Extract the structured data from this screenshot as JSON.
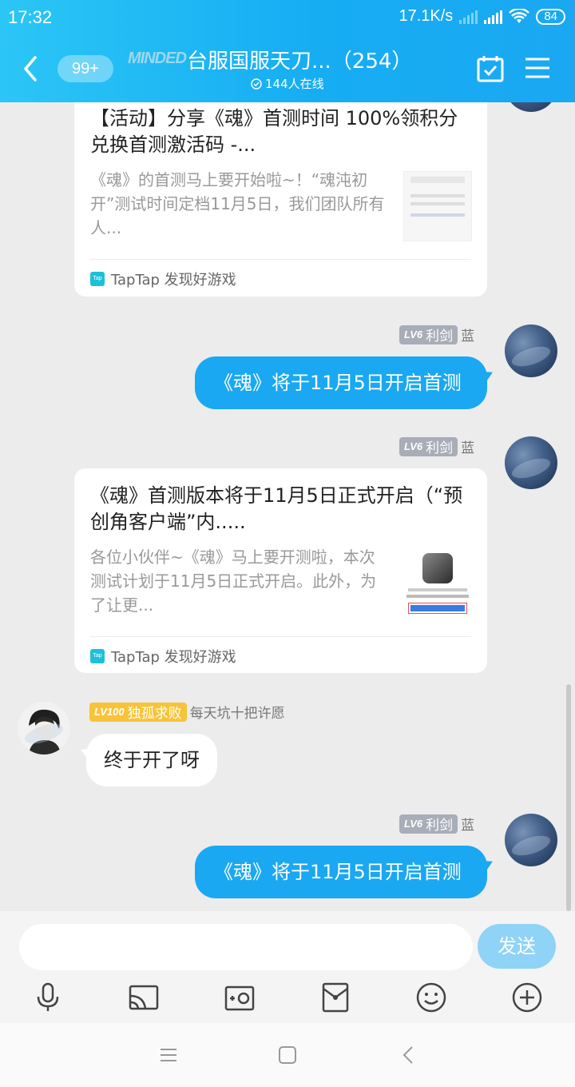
{
  "status_bar": {
    "time": "17:32",
    "speed": "17.1K/s",
    "battery": "84"
  },
  "header": {
    "unread_badge": "99+",
    "brand_logo": "MINDED",
    "title": "台服国服天刀...（254）",
    "online": "144人在线",
    "icons": [
      "back-icon",
      "calendar-check-icon",
      "menu-icon"
    ]
  },
  "messages": [
    {
      "type": "link_card",
      "title": "【活动】分享《魂》首测时间 100%领积分兑换首测激活码 -...",
      "description": "《魂》的首测马上要开始啦~！“魂沌初开”测试时间定档11月5日，我们团队所有人...",
      "source": "TapTap 发现好游戏",
      "source_logo": "Tap"
    },
    {
      "type": "text_self",
      "level": "LV6",
      "rank": "利剑",
      "name": "蓝",
      "text": "《魂》将于11月5日开启首测"
    },
    {
      "type": "link_card",
      "level": "LV6",
      "rank": "利剑",
      "name": "蓝",
      "title": "《魂》首测版本将于11月5日正式开启（“预创角客户端”内.....",
      "description": "各位小伙伴~《魂》马上要开测啦，本次测试计划于11月5日正式开启。此外，为了让更...",
      "source": "TapTap 发现好游戏",
      "source_logo": "Tap"
    },
    {
      "type": "text_other",
      "level": "LV100",
      "rank": "独孤求败",
      "name": "每天坑十把许愿",
      "text": "终于开了呀"
    },
    {
      "type": "text_self",
      "level": "LV6",
      "rank": "利剑",
      "name": "蓝",
      "text": "《魂》将于11月5日开启首测"
    }
  ],
  "composer": {
    "input_value": "",
    "send_label": "发送",
    "tools": [
      "microphone-icon",
      "cast-screen-icon",
      "photo-icon",
      "red-packet-icon",
      "emoji-icon",
      "plus-icon"
    ]
  },
  "colors": {
    "accent": "#1aa8f2",
    "background": "#ececec"
  }
}
